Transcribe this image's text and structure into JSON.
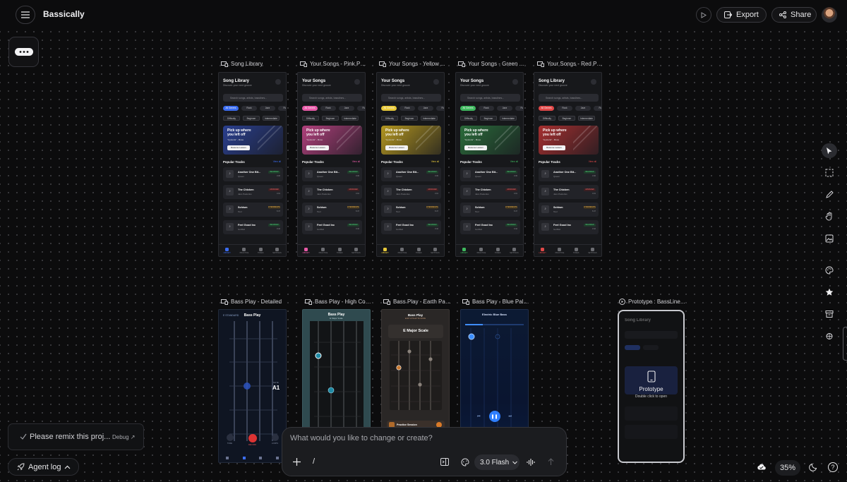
{
  "app": {
    "title": "Bassically"
  },
  "header": {
    "export_label": "Export",
    "share_label": "Share"
  },
  "song_screens": {
    "search_placeholder": "Search songs, artists, basslines...",
    "subtitle": "Discover your next groove",
    "chips": [
      "All Genres",
      "Rock",
      "Jazz",
      "Funk"
    ],
    "filters": [
      "Difficulty",
      "Beginner",
      "Intermediate"
    ],
    "hero_title_1": "Pick up where",
    "hero_title_2": "you left off",
    "hero_sub": "\"Hysteria\" - Muse",
    "hero_button": "Resume Lesson",
    "popular": "Popular Tracks",
    "view_all": "View all",
    "tracks": [
      {
        "name": "Another One Bit...",
        "artist": "Queen",
        "level": "BEGINNER",
        "dur": "3:36"
      },
      {
        "name": "The Chicken",
        "artist": "Jaco Pastorius",
        "level": "ADVANCED",
        "dur": "4:01"
      },
      {
        "name": "Schism",
        "artist": "Tool",
        "level": "INTERMEDIATE",
        "dur": "6:47"
      },
      {
        "name": "Feel Good Inc",
        "artist": "Gorillaz",
        "level": "BEGINNER",
        "dur": "3:42"
      }
    ],
    "nav": [
      "LIBRARY",
      "PRACTICE",
      "TONES",
      "SETTINGS"
    ]
  },
  "frames_row1": [
    {
      "label": "Song Library",
      "title": "Song Library",
      "accent": "#3b6cf0",
      "hero": "#2a3f8f"
    },
    {
      "label": "Your Songs - Pink Pa...",
      "title": "Your Songs",
      "accent": "#e85aa8",
      "hero": "#b0407c"
    },
    {
      "label": "Your Songs - Yellow ...",
      "title": "Your Songs",
      "accent": "#e8c93a",
      "hero": "#b39620"
    },
    {
      "label": "Your Songs - Green ...",
      "title": "Your Songs",
      "accent": "#3fb85e",
      "hero": "#2a6b3a"
    },
    {
      "label": "Your Songs - Red Pal...",
      "title": "Song Library",
      "accent": "#e04848",
      "hero": "#a52f2f"
    }
  ],
  "frames_row2": [
    {
      "label": "Bass Play - Detailed",
      "title": "Bass Play",
      "sub": "E STANDARD",
      "note": "A1",
      "note_label": "NOTE"
    },
    {
      "label": "Bass Play - High Con...",
      "title": "Bass Play",
      "sub": "E Major Scale"
    },
    {
      "label": "Bass Play - Earth Pal...",
      "title": "Bass Play",
      "sub": "EARTH PALETTE MODE",
      "scale": "E Major Scale",
      "card": "Practice Session"
    },
    {
      "label": "Bass Play - Blue Pale...",
      "title": "Electric Blue Bass"
    }
  ],
  "detailed_controls": [
    "TUNE",
    "RECORD",
    "LOOPS"
  ],
  "prototype": {
    "label": "Prototype : BassLine...",
    "overlay_title": "Prototype",
    "overlay_hint": "Double click to open",
    "screen_title": "Song Library"
  },
  "status": {
    "text": "Please remix this proj...",
    "debug": "Debug ↗"
  },
  "agent_log": {
    "label": "Agent log"
  },
  "prompt": {
    "placeholder": "What would you like to change or create?",
    "slash": "/",
    "model": "3.0 Flash"
  },
  "zoom": {
    "level": "35%"
  },
  "colors": {
    "background": "#0c0c0d",
    "panel": "#1b1c1f",
    "border": "#34353a"
  }
}
